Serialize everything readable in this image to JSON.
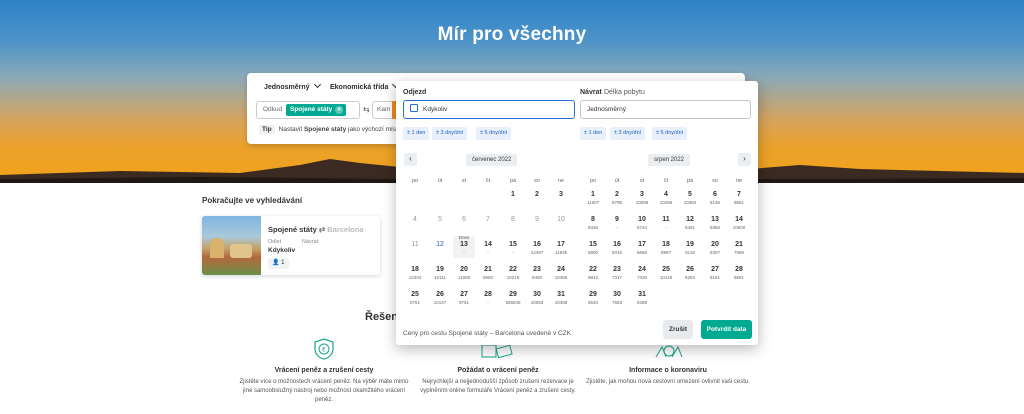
{
  "hero": {
    "title": "Mír pro všechny"
  },
  "search": {
    "trip_type": "Jednosměrný",
    "cabin_class": "Ekonomická třída",
    "from_label": "Odkud",
    "from_chip": "Spojené státy",
    "to_label": "Kam",
    "tip_tag": "Tip",
    "tip_text_before": "Nastavit ",
    "tip_bold": "Spojené státy",
    "tip_text_after": " jako výchozí místo o"
  },
  "continue": {
    "title": "Pokračujte ve vyhledávání",
    "card": {
      "route_from": "Spojené státy",
      "route_sep": "⇄",
      "route_to": "Barcelona",
      "depart_label": "Odlet",
      "return_label": "Návrat",
      "depart_value": "Kdykoliv",
      "passengers": "1"
    }
  },
  "section_heading": "Řešení",
  "features": [
    {
      "title": "Vrácení peněz a zrušení cesty",
      "text": "Zjistěte více o možnostech vrácení peněz. Na výběr máte mimo jiné samoobslužný nástroj nebo možnost okamžitého vrácení peněz."
    },
    {
      "title": "Požádat o vrácení peněz",
      "text": "Nejrychlejší a nejjednodušší způsob zrušení rezervace je vyplněním online formuláře Vrácení peněz a zrušení cesty."
    },
    {
      "title": "Informace o koronaviru",
      "text": "Zjistěte, jak mohou nová cestovní omezení ovlivnit vaši cestu."
    }
  ],
  "datepicker": {
    "depart_label": "Odjezd",
    "return_label": "Návrat",
    "stay_tab": "Délka pobytu",
    "depart_value": "Kdykoliv",
    "return_value": "Jednosměrný",
    "flex_options": [
      "± 1 den",
      "± 3 dny/dní",
      "± 5 dny/dní"
    ],
    "weekdays": [
      "po",
      "út",
      "st",
      "čt",
      "pá",
      "so",
      "ne"
    ],
    "today_label": "Dnes",
    "months": [
      {
        "name": "červenec 2022",
        "days": [
          {
            "d": "1",
            "p": "",
            "s": ""
          },
          {
            "d": "2",
            "p": "",
            "s": ""
          },
          {
            "d": "3",
            "p": "",
            "s": ""
          },
          {
            "d": "4",
            "p": "",
            "s": "past"
          },
          {
            "d": "5",
            "p": "",
            "s": "past"
          },
          {
            "d": "6",
            "p": "",
            "s": "past"
          },
          {
            "d": "7",
            "p": "",
            "s": "past"
          },
          {
            "d": "8",
            "p": "",
            "s": "past"
          },
          {
            "d": "9",
            "p": "",
            "s": "past"
          },
          {
            "d": "10",
            "p": "",
            "s": "past"
          },
          {
            "d": "11",
            "p": "",
            "s": "past"
          },
          {
            "d": "12",
            "p": "",
            "s": "hl"
          },
          {
            "d": "13",
            "p": "-",
            "s": "today"
          },
          {
            "d": "14",
            "p": "-",
            "s": ""
          },
          {
            "d": "15",
            "p": "-",
            "s": ""
          },
          {
            "d": "16",
            "p": "12497",
            "s": ""
          },
          {
            "d": "17",
            "p": "11835",
            "s": ""
          },
          {
            "d": "18",
            "p": "12334",
            "s": ""
          },
          {
            "d": "19",
            "p": "10111",
            "s": ""
          },
          {
            "d": "20",
            "p": "11085",
            "s": ""
          },
          {
            "d": "21",
            "p": "9560",
            "s": ""
          },
          {
            "d": "22",
            "p": "10219",
            "s": ""
          },
          {
            "d": "23",
            "p": "9460",
            "s": ""
          },
          {
            "d": "24",
            "p": "10486",
            "s": ""
          },
          {
            "d": "25",
            "p": "9751",
            "s": ""
          },
          {
            "d": "26",
            "p": "10147",
            "s": ""
          },
          {
            "d": "27",
            "p": "9751",
            "s": ""
          },
          {
            "d": "28",
            "p": "-",
            "s": ""
          },
          {
            "d": "29",
            "p": "555849",
            "s": ""
          },
          {
            "d": "30",
            "p": "10083",
            "s": ""
          },
          {
            "d": "31",
            "p": "10458",
            "s": ""
          }
        ],
        "offset": 4
      },
      {
        "name": "srpen 2022",
        "days": [
          {
            "d": "1",
            "p": "11607",
            "s": ""
          },
          {
            "d": "2",
            "p": "8798",
            "s": ""
          },
          {
            "d": "3",
            "p": "10598",
            "s": ""
          },
          {
            "d": "4",
            "p": "10486",
            "s": ""
          },
          {
            "d": "5",
            "p": "10384",
            "s": ""
          },
          {
            "d": "6",
            "p": "8136",
            "s": ""
          },
          {
            "d": "7",
            "p": "9681",
            "s": ""
          },
          {
            "d": "8",
            "p": "9336",
            "s": ""
          },
          {
            "d": "9",
            "p": "-",
            "s": ""
          },
          {
            "d": "10",
            "p": "8744",
            "s": ""
          },
          {
            "d": "11",
            "p": "-",
            "s": ""
          },
          {
            "d": "12",
            "p": "9451",
            "s": ""
          },
          {
            "d": "13",
            "p": "9360",
            "s": ""
          },
          {
            "d": "14",
            "p": "10600",
            "s": ""
          },
          {
            "d": "15",
            "p": "5800",
            "s": ""
          },
          {
            "d": "16",
            "p": "5016",
            "s": ""
          },
          {
            "d": "17",
            "p": "6668",
            "s": ""
          },
          {
            "d": "18",
            "p": "8997",
            "s": ""
          },
          {
            "d": "19",
            "p": "9118",
            "s": ""
          },
          {
            "d": "20",
            "p": "8307",
            "s": ""
          },
          {
            "d": "21",
            "p": "7086",
            "s": ""
          },
          {
            "d": "22",
            "p": "6842",
            "s": ""
          },
          {
            "d": "23",
            "p": "7317",
            "s": ""
          },
          {
            "d": "24",
            "p": "7330",
            "s": ""
          },
          {
            "d": "25",
            "p": "10119",
            "s": ""
          },
          {
            "d": "26",
            "p": "9284",
            "s": ""
          },
          {
            "d": "27",
            "p": "8161",
            "s": ""
          },
          {
            "d": "28",
            "p": "9681",
            "s": ""
          },
          {
            "d": "29",
            "p": "5640",
            "s": ""
          },
          {
            "d": "30",
            "p": "7683",
            "s": ""
          },
          {
            "d": "31",
            "p": "8398",
            "s": ""
          }
        ],
        "offset": 0
      }
    ],
    "footer_note": "Ceny pro cestu Spojené státy – Barcelona uvedené v CZK",
    "cancel_label": "Zrušit",
    "confirm_label": "Potvrdit data"
  }
}
